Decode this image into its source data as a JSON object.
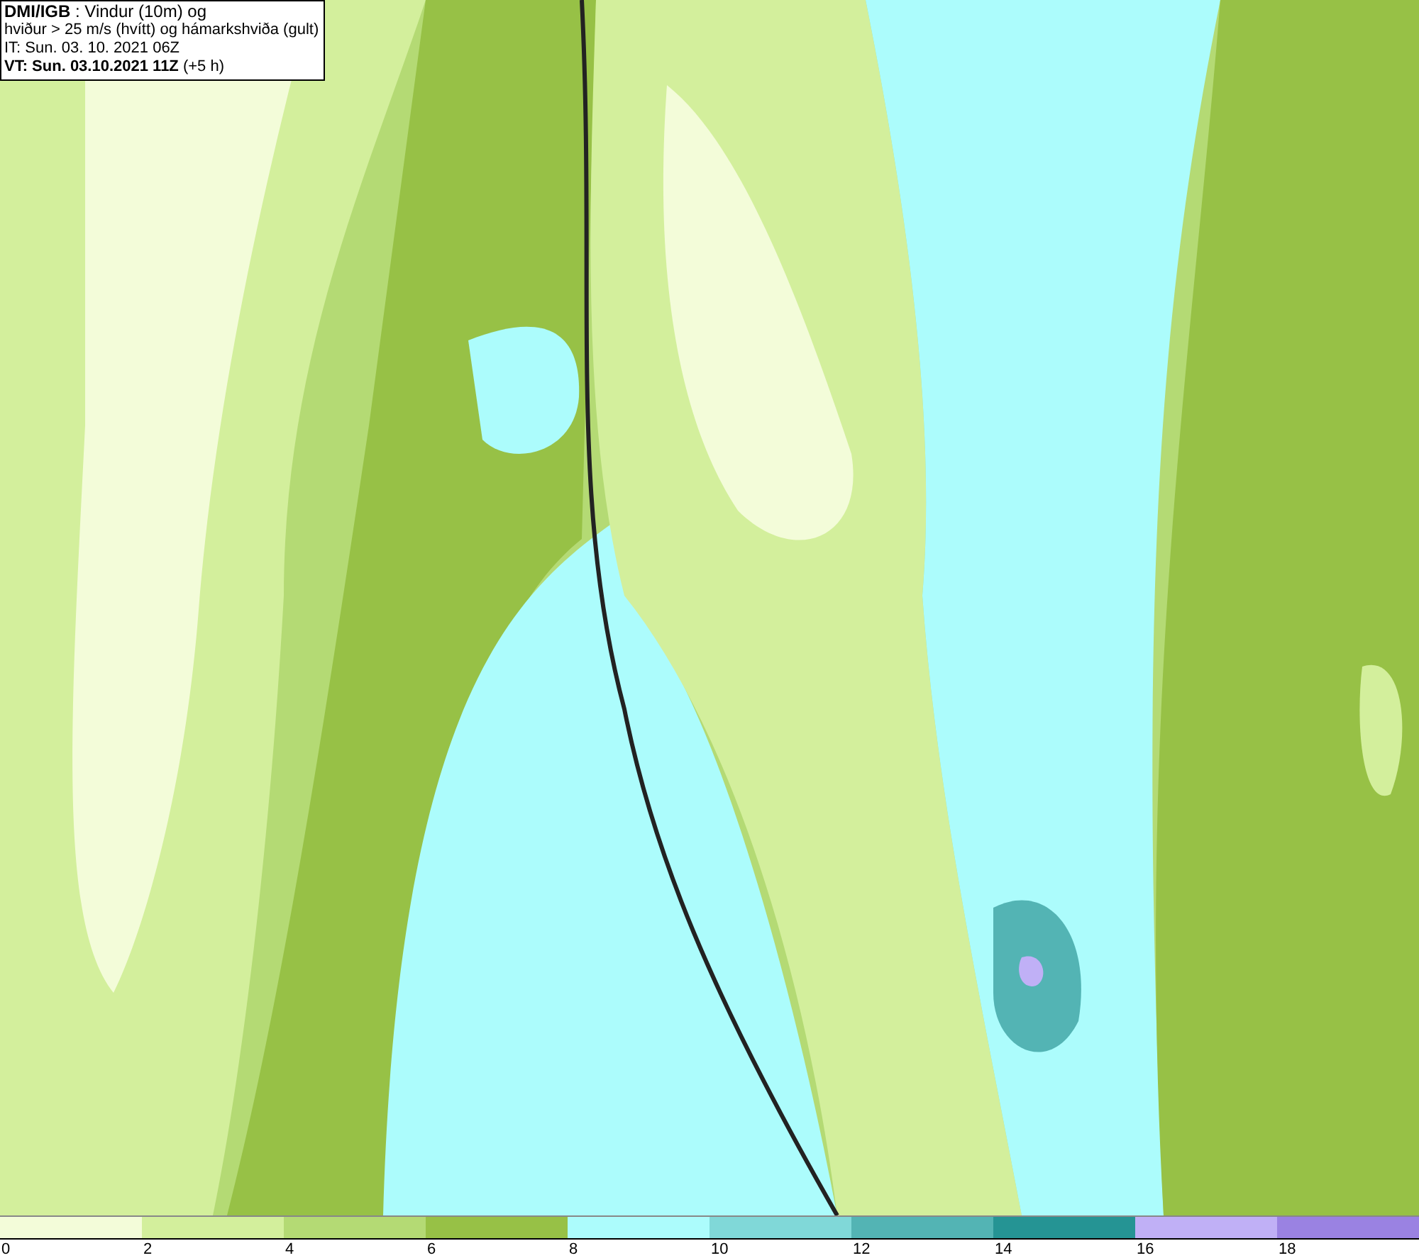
{
  "info_box": {
    "lines": [
      "**DMI/IGB** : Vindur (10m) og",
      "hviður > 25 m/s (hvítt) og hámarkshviða (gult)",
      "IT: Sun. 03. 10. 2021 06Z",
      "**VT: Sun. 03.10.2021 11Z** (+5 h)"
    ]
  },
  "legend": {
    "bins": [
      {
        "color": "#f3fcd9"
      },
      {
        "color": "#d3ef9c"
      },
      {
        "color": "#b4da74"
      },
      {
        "color": "#97c146"
      },
      {
        "color": "#acfcfc"
      },
      {
        "color": "#80d8d8"
      },
      {
        "color": "#53b4b4"
      },
      {
        "color": "#259494"
      },
      {
        "color": "#c0b0f6"
      },
      {
        "color": "#9a82e2"
      }
    ],
    "ticks": [
      "0",
      "2",
      "4",
      "6",
      "8",
      "10",
      "12",
      "14",
      "16",
      "18"
    ]
  }
}
